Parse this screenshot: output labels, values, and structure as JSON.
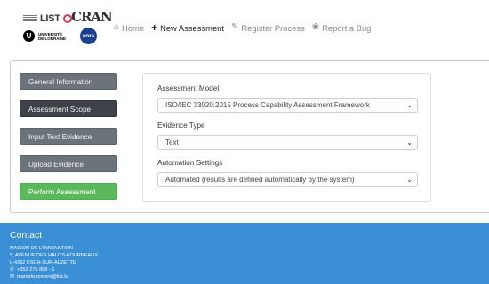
{
  "logos": {
    "list": "LIST",
    "cran": "CRAN",
    "ul_initial": "U",
    "ul_line1": "UNIVERSITÉ",
    "ul_line2": "DE LORRAINE",
    "cnrs": "cnrs"
  },
  "nav": {
    "items": [
      {
        "label": "Home",
        "icon": "home-icon"
      },
      {
        "label": "New Assessment",
        "icon": "plus-icon"
      },
      {
        "label": "Register Process",
        "icon": "pencil-icon"
      },
      {
        "label": "Report a Bug",
        "icon": "bug-icon"
      }
    ]
  },
  "steps": {
    "items": [
      {
        "label": "General Information"
      },
      {
        "label": "Assessment Scope"
      },
      {
        "label": "Input Text Evidence"
      },
      {
        "label": "Upload Evidence"
      },
      {
        "label": "Perform Assessment"
      }
    ]
  },
  "form": {
    "model_label": "Assessment Model",
    "model_value": "ISO/IEC 33020:2015 Process Capability Assessment Framework",
    "evidence_label": "Evidence Type",
    "evidence_value": "Text",
    "automation_label": "Automation Settings",
    "automation_value": "Automated (results are defined automatically by the system)"
  },
  "footer": {
    "title": "Contact",
    "addr1": "MAISON DE L'INNOVATION",
    "addr2": "5, AVENUE DES HAUTS-FOURNEAUX",
    "addr3": "L-4362 ESCH-SUR-ALZETTE",
    "phone": "+352 275 888 - 1",
    "email": "marcelo.romero@list.lu"
  },
  "colors": {
    "footer_bg": "#3b8fd4",
    "step_active": "#5cb85c",
    "step_default": "#6c737b",
    "step_current": "#3e4349"
  }
}
